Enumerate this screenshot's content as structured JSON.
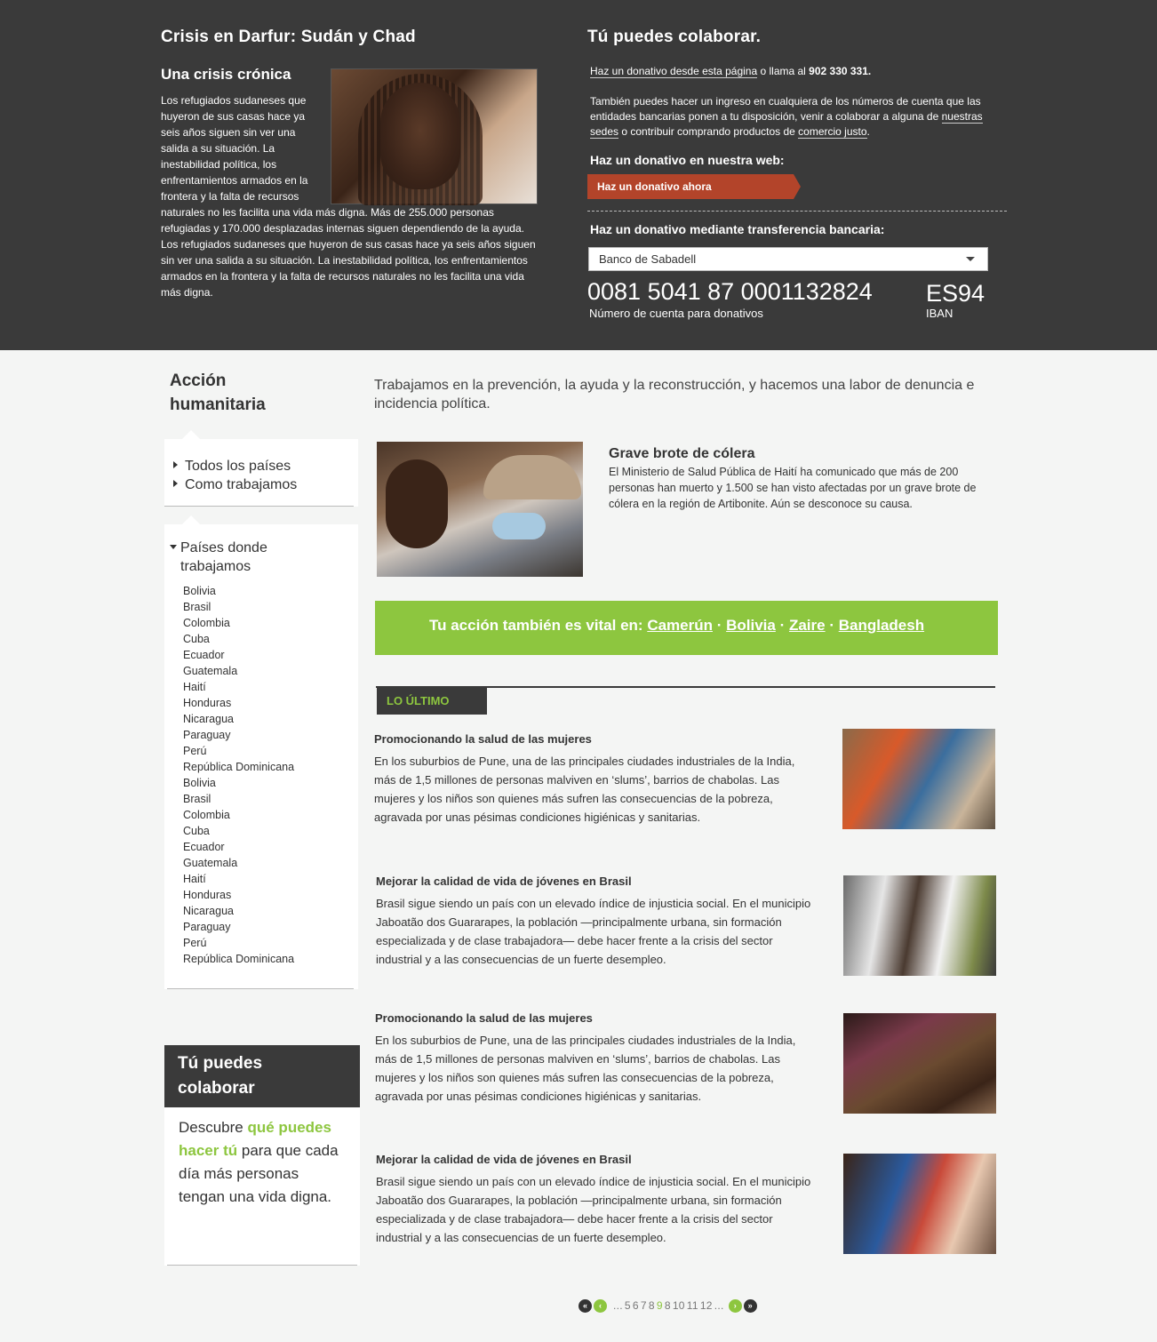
{
  "hero": {
    "title": "Crisis en Darfur: Sudán y Chad",
    "subtitle": "Una crisis crónica",
    "body_short": "Los refugiados sudaneses que huyeron de sus casas hace ya seis años siguen sin ver una salida a su situación. La inestabilidad política, los enfrentamientos armados en la frontera y la falta de recursos",
    "body_long_1": "naturales no les facilita una vida más digna. Más de 255.000 personas refugiadas y 170.000 desplazadas internas siguen dependiendo de la ayuda.",
    "body_long_2": "Los refugiados sudaneses que huyeron de sus casas hace ya seis años siguen sin ver una salida a su situación. La inestabilidad política, los enfrentamientos armados en la frontera y la falta de recursos naturales no les facilita una vida más digna."
  },
  "collaborate": {
    "title": "Tú puedes colaborar.",
    "donate_link": "Haz un donativo desde esta página",
    "call_text": " o llama al ",
    "phone": "902 330 331.",
    "para2_a": "También puedes hacer un ingreso en cualquiera de los números de cuenta que las entidades bancarias ponen a tu disposición, venir a colaborar a alguna de ",
    "sedes_link": "nuestras sedes",
    "para2_b": " o contribuir comprando productos de ",
    "comercio_link": "comercio justo",
    "para2_c": ".",
    "web_heading": "Haz un donativo en nuestra web:",
    "donate_button": "Haz un donativo ahora",
    "transfer_heading": "Haz un donativo mediante transferencia bancaria:",
    "bank_selected": "Banco de Sabadell",
    "account_number": "0081 5041 87 0001132824",
    "account_label": "Número de cuenta para donativos",
    "iban": "ES94",
    "iban_label": "IBAN"
  },
  "sidebar": {
    "title_line1": "Acción",
    "title_line2": "humanitaria",
    "nav": [
      "Todos los países",
      "Como trabajamos"
    ],
    "countries_heading_1": "Países donde",
    "countries_heading_2": "trabajamos",
    "countries": [
      "Bolivia",
      "Brasil",
      "Colombia",
      "Cuba",
      "Ecuador",
      "Guatemala",
      "Haití",
      "Honduras",
      "Nicaragua",
      "Paraguay",
      "Perú",
      "República Dominicana",
      "Bolivia",
      "Brasil",
      "Colombia",
      "Cuba",
      "Ecuador",
      "Guatemala",
      "Haití",
      "Honduras",
      "Nicaragua",
      "Paraguay",
      "Perú",
      "República Dominicana"
    ],
    "collab_title_1": "Tú puedes",
    "collab_title_2": "colaborar",
    "collab_text_a": "Descubre ",
    "collab_highlight": "qué puedes hacer tú",
    "collab_text_b": " para que cada día más personas tengan una vida digna."
  },
  "main": {
    "intro": "Trabajamos en la prevención, la ayuda y la reconstrucción, y hacemos una labor de denuncia e incidencia política.",
    "feature_title": "Grave brote de cólera",
    "feature_text": "El Ministerio de Salud Pública de Haití ha comunicado que más de 200 personas han muerto y 1.500 se han visto afectadas por un grave brote de cólera en la región de Artibonite. Aún se desconoce su causa.",
    "vital_prefix": "Tu acción también es vital en: ",
    "vital_links": [
      "Camerún",
      "Bolivia",
      "Zaire",
      "Bangladesh"
    ],
    "vital_sep": " · ",
    "latest_label": "LO ÚLTIMO",
    "news": [
      {
        "title": "Promocionando la salud de las mujeres",
        "text": "En los suburbios de Pune, una de las principales ciudades industriales de la India, más de 1,5 millones de personas malviven en ‘slums’, barrios de chabolas. Las mujeres y los niños son quienes más sufren las consecuencias de la pobreza, agravada por unas pésimas condiciones higiénicas y sanitarias."
      },
      {
        "title": "Mejorar la calidad de vida de jóvenes en Brasil",
        "text": "Brasil sigue siendo un país con un elevado índice de injusticia social. En el municipio Jaboatão dos Guararapes, la población —principalmente urbana, sin formación  especializada y de clase trabajadora— debe hacer frente a la crisis del sector industrial y a las consecuencias de un fuerte desempleo."
      },
      {
        "title": "Promocionando la salud de las mujeres",
        "text": "En los suburbios de Pune, una de las principales ciudades industriales de la India, más de 1,5 millones de personas malviven en ‘slums’, barrios de chabolas. Las mujeres y los niños son quienes más sufren las consecuencias de la pobreza, agravada por unas pésimas condiciones higiénicas y sanitarias."
      },
      {
        "title": "Mejorar la calidad de vida de jóvenes en Brasil",
        "text": "Brasil sigue siendo un país con un elevado índice de injusticia social. En el municipio Jaboatão dos Guararapes, la población —principalmente urbana, sin formación  especializada y de clase trabajadora— debe hacer frente a la crisis del sector industrial y a las consecuencias de un fuerte desempleo."
      }
    ]
  },
  "pagination": {
    "ellipsis_left": "...",
    "pages": [
      "5",
      "6",
      "7",
      "8",
      "9",
      "8",
      "10",
      "11",
      "12"
    ],
    "current_index": 4,
    "ellipsis_right": "..."
  },
  "colors": {
    "accent_green": "#8dc63f",
    "dark": "#3a3a3a",
    "donate_red": "#b3442a"
  }
}
